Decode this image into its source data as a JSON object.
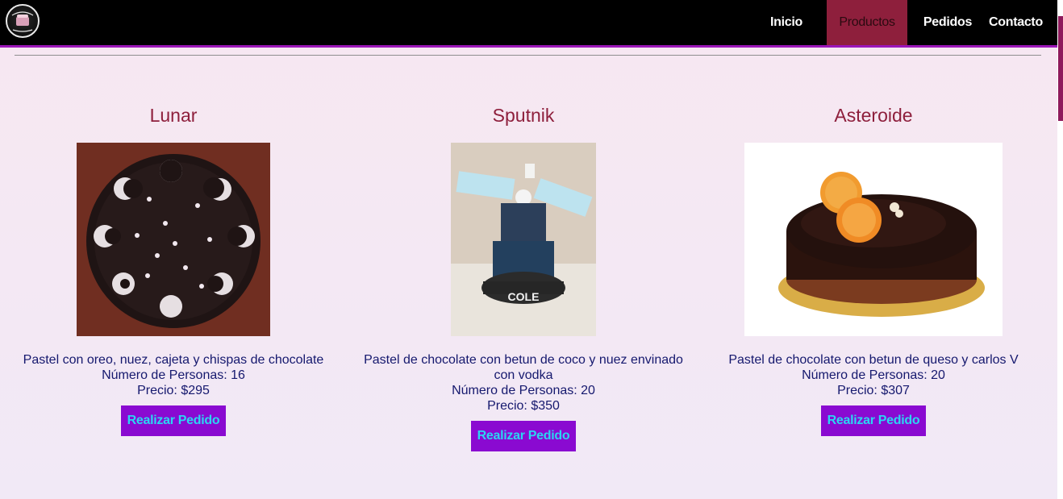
{
  "nav": {
    "logo_alt": "Paralelos Galácticos",
    "items": [
      {
        "label": "Inicio"
      },
      {
        "label": "Productos"
      },
      {
        "label": "Pedidos"
      },
      {
        "label": "Contacto"
      }
    ]
  },
  "products": [
    {
      "name": "Lunar",
      "description": "Pastel con oreo, nuez, cajeta y chispas de chocolate",
      "people": "Número de Personas: 16",
      "price": "Precio: $295",
      "button": "Realizar Pedido"
    },
    {
      "name": "Sputnik",
      "description": "Pastel de chocolate con betun de coco y nuez envinado con vodka",
      "people": "Número de Personas: 20",
      "price": "Precio: $350",
      "button": "Realizar Pedido",
      "cake_label": "COLE"
    },
    {
      "name": "Asteroide",
      "description": "Pastel de chocolate con betun de queso y carlos V",
      "people": "Número de Personas: 20",
      "price": "Precio: $307",
      "button": "Realizar Pedido"
    }
  ],
  "colors": {
    "nav_bg": "#000000",
    "nav_active": "#8e1f3c",
    "title": "#8e1f3c",
    "text": "#15186e",
    "button_bg": "#8a0ad1",
    "button_text": "#2ad6f2"
  }
}
